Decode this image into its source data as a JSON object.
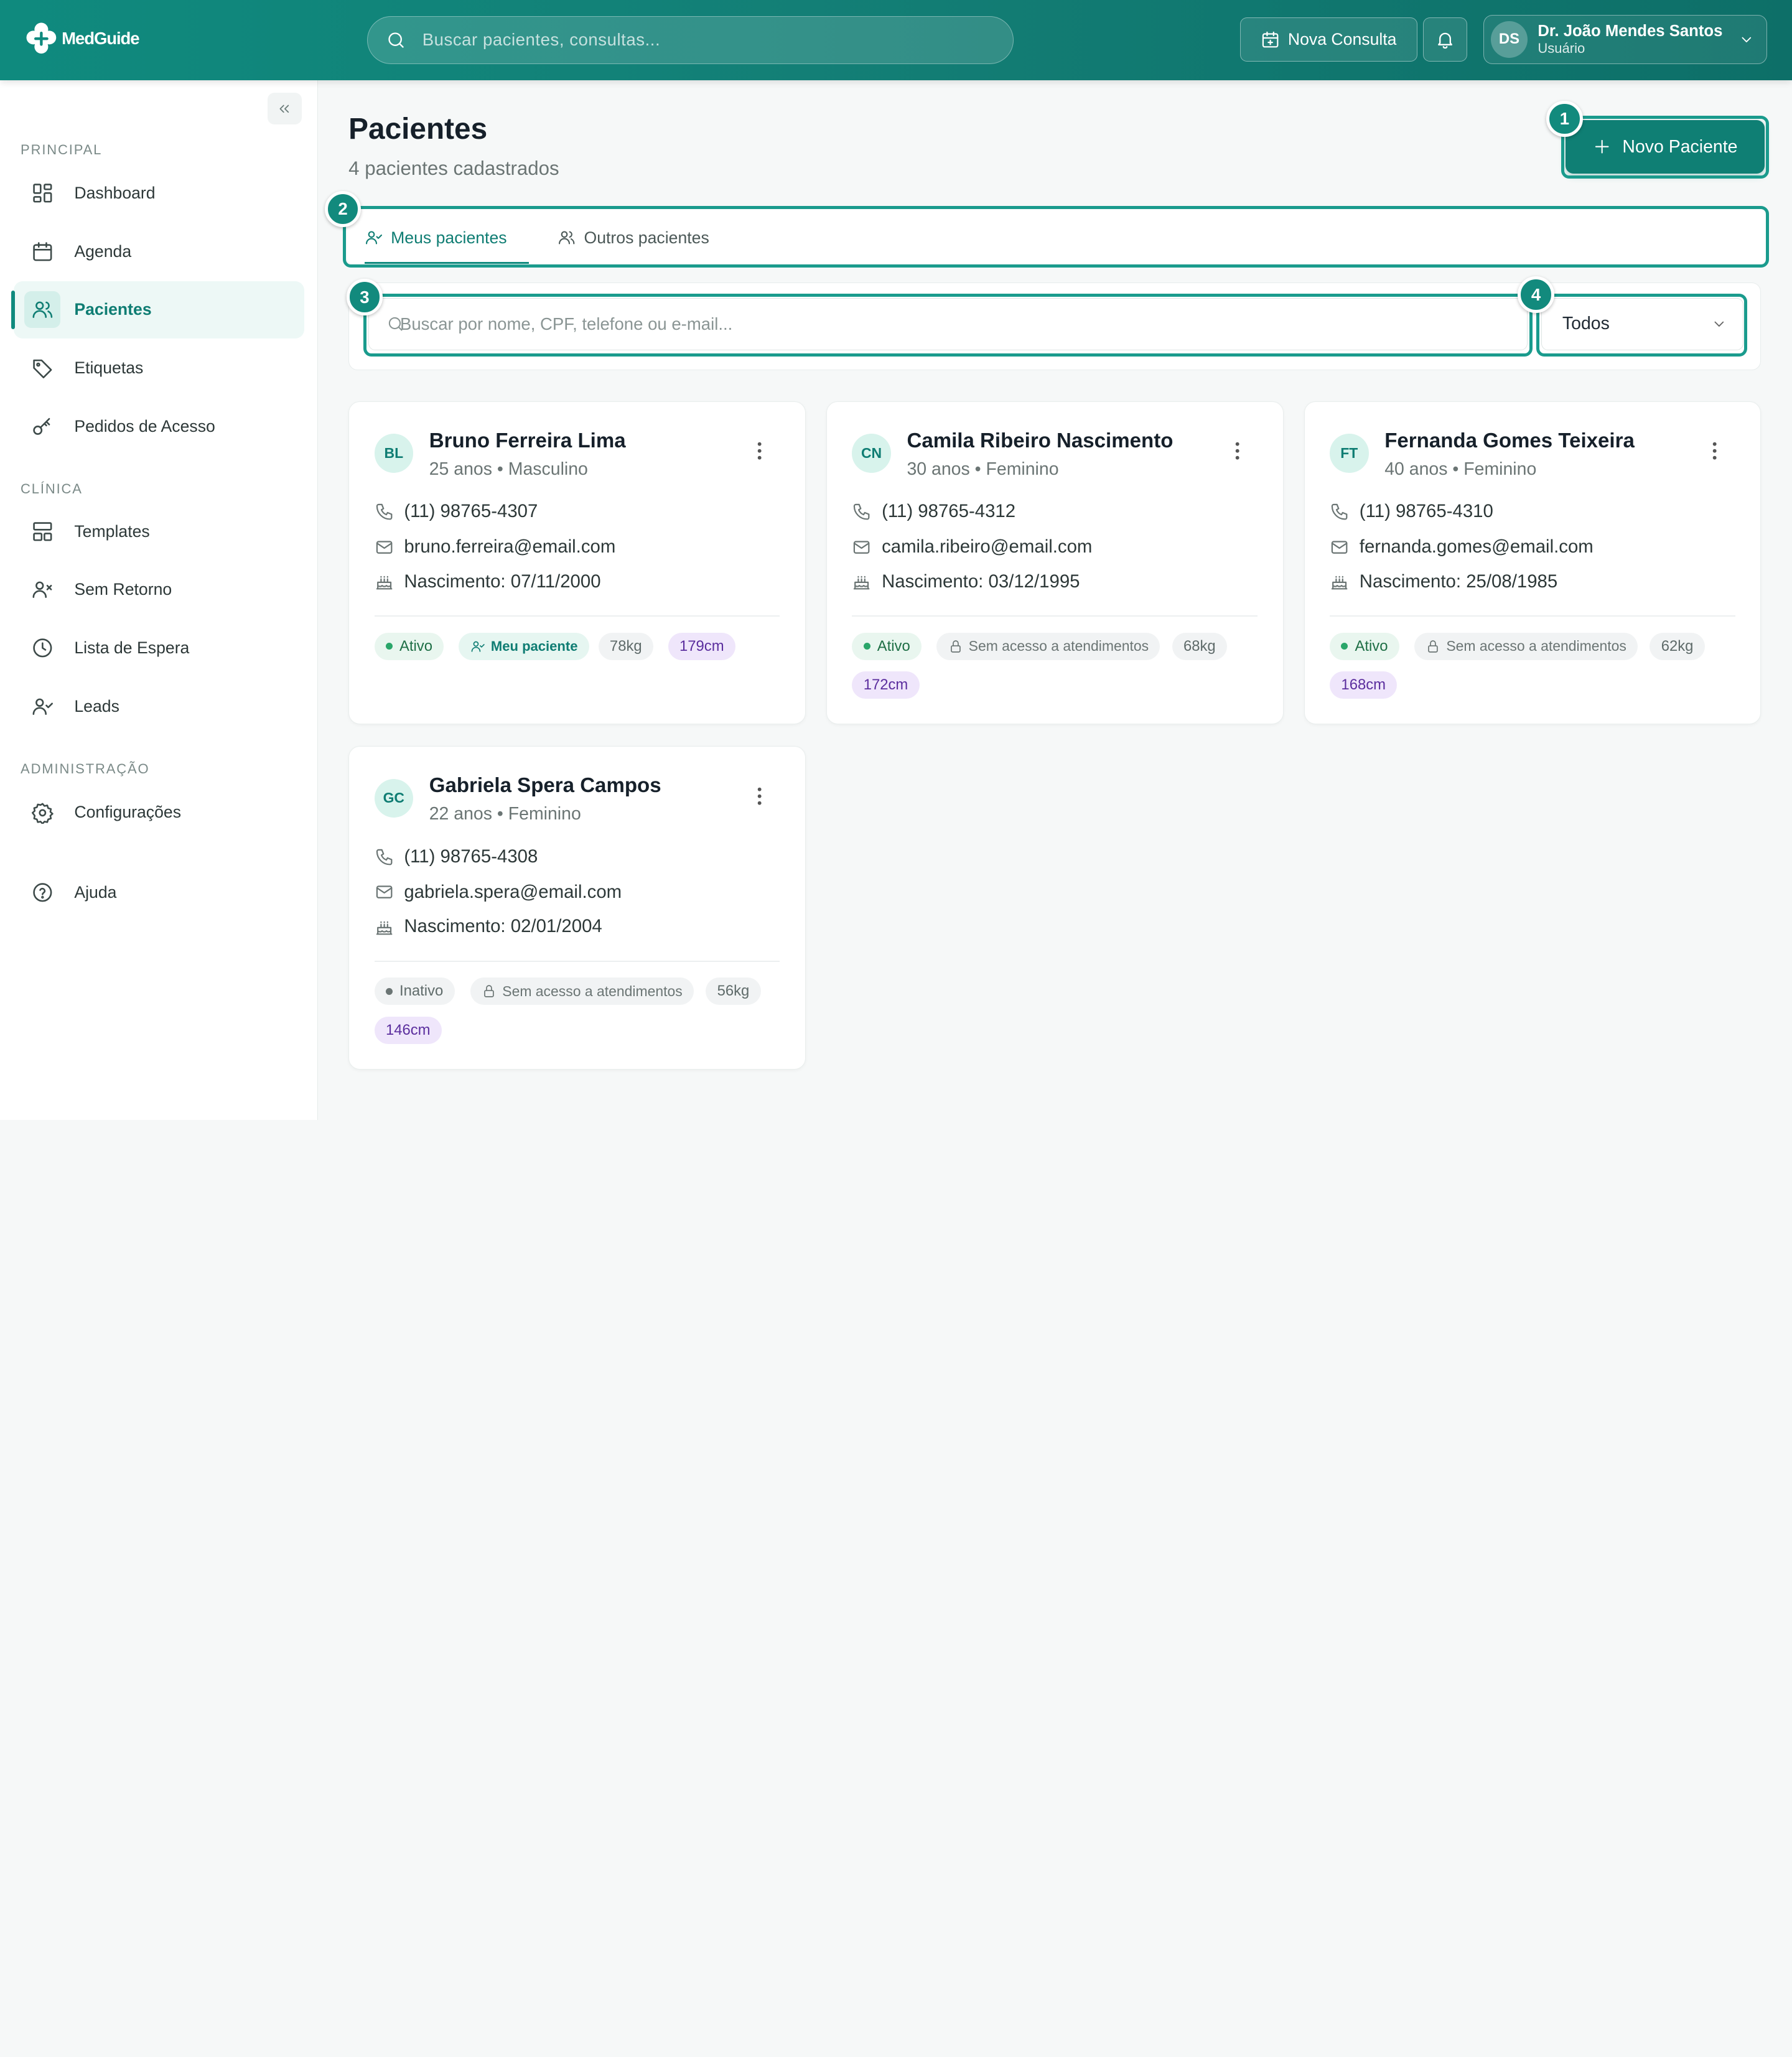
{
  "header": {
    "brand": "MedGuide",
    "search_placeholder": "Buscar pacientes, consultas...",
    "new_consult_label": "Nova Consulta",
    "user": {
      "initials": "DS",
      "name": "Dr. João Mendes Santos",
      "role": "Usuário"
    }
  },
  "sidebar": {
    "sections": [
      {
        "title": "PRINCIPAL",
        "items": [
          {
            "label": "Dashboard",
            "icon": "dashboard-icon"
          },
          {
            "label": "Agenda",
            "icon": "calendar-icon"
          },
          {
            "label": "Pacientes",
            "icon": "users-icon",
            "active": true
          },
          {
            "label": "Etiquetas",
            "icon": "tag-icon"
          },
          {
            "label": "Pedidos de Acesso",
            "icon": "key-icon"
          }
        ]
      },
      {
        "title": "CLÍNICA",
        "items": [
          {
            "label": "Templates",
            "icon": "template-icon"
          },
          {
            "label": "Sem Retorno",
            "icon": "user-x-icon"
          },
          {
            "label": "Lista de Espera",
            "icon": "clock-icon"
          },
          {
            "label": "Leads",
            "icon": "user-check-icon"
          }
        ]
      },
      {
        "title": "ADMINISTRAÇÃO",
        "items": [
          {
            "label": "Configurações",
            "icon": "gear-icon"
          }
        ]
      }
    ],
    "help_label": "Ajuda"
  },
  "main": {
    "title": "Pacientes",
    "subtitle": "4 pacientes cadastrados",
    "new_patient_label": "Novo Paciente",
    "tabs": [
      {
        "label": "Meus pacientes",
        "active": true
      },
      {
        "label": "Outros pacientes",
        "active": false
      }
    ],
    "filter": {
      "search_placeholder": "Buscar por nome, CPF, telefone ou e-mail...",
      "status_value": "Todos"
    },
    "callouts": [
      "1",
      "2",
      "3",
      "4"
    ]
  },
  "patients": [
    {
      "initials": "BL",
      "name": "Bruno Ferreira Lima",
      "meta": "25 anos • Masculino",
      "phone": "(11) 98765-4307",
      "email": "bruno.ferreira@email.com",
      "birth": "Nascimento: 07/11/2000",
      "status": "Ativo",
      "access": "Meu paciente",
      "weight": "78kg",
      "height": "179cm"
    },
    {
      "initials": "CN",
      "name": "Camila Ribeiro Nascimento",
      "meta": "30 anos • Feminino",
      "phone": "(11) 98765-4312",
      "email": "camila.ribeiro@email.com",
      "birth": "Nascimento: 03/12/1995",
      "status": "Ativo",
      "access": "Sem acesso a atendimentos",
      "weight": "68kg",
      "height": "172cm"
    },
    {
      "initials": "FT",
      "name": "Fernanda Gomes Teixeira",
      "meta": "40 anos • Feminino",
      "phone": "(11) 98765-4310",
      "email": "fernanda.gomes@email.com",
      "birth": "Nascimento: 25/08/1985",
      "status": "Ativo",
      "access": "Sem acesso a atendimentos",
      "weight": "62kg",
      "height": "168cm"
    },
    {
      "initials": "GC",
      "name": "Gabriela Spera Campos",
      "meta": "22 anos • Feminino",
      "phone": "(11) 98765-4308",
      "email": "gabriela.spera@email.com",
      "birth": "Nascimento: 02/01/2004",
      "status": "Inativo",
      "access": "Sem acesso a atendimentos",
      "weight": "56kg",
      "height": "146cm"
    }
  ],
  "colors": {
    "brand": "#0f8a7e",
    "accent_dark": "#0f7f74",
    "callout": "#1a9b8d",
    "height_chip": "#efe6fb"
  }
}
